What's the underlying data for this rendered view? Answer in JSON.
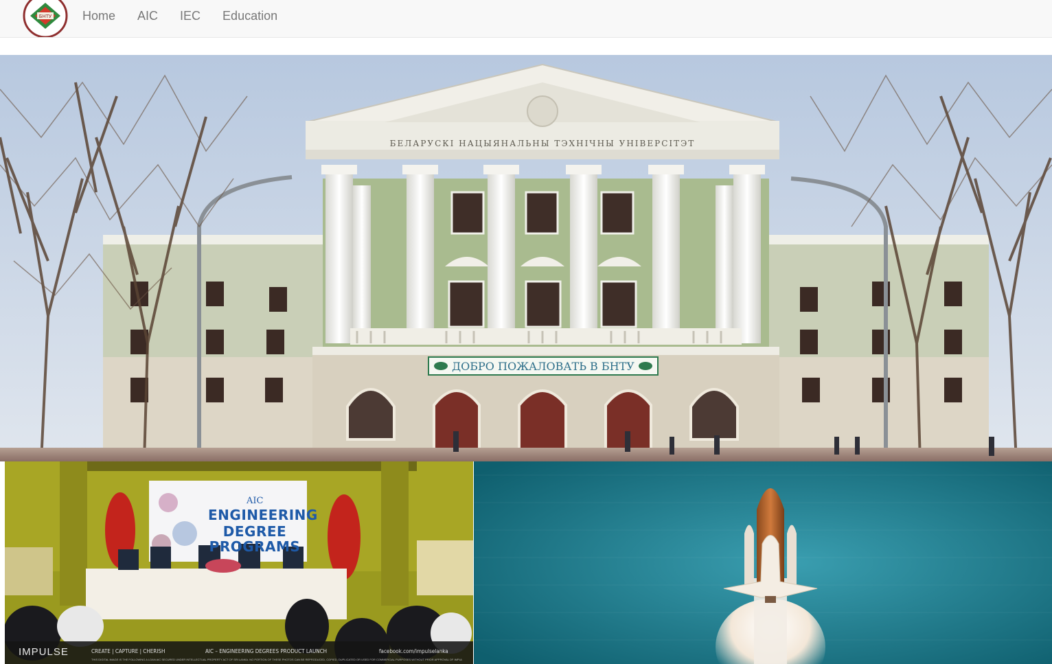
{
  "navbar": {
    "logo_text": "БНТУ",
    "links": [
      "Home",
      "AIC",
      "IEC",
      "Education"
    ]
  },
  "hero": {
    "facade_inscription": "БЕЛАРУСКІ НАЦЫЯНАЛЬНЫ ТЭХНІЧНЫ УНІВЕРСІТЭТ",
    "welcome_banner": "ДОБРО ПОЖАЛОВАТЬ В БНТУ"
  },
  "event_panel": {
    "banner_brand": "AIC",
    "banner_line1": "ENGINEERING",
    "banner_line2": "DEGREE",
    "banner_line3": "PROGRAMS",
    "footer_brand": "IMPULSE",
    "footer_tagline": "CREATE | CAPTURE | CHERISH",
    "footer_caption": "AIC – ENGINEERING DEGREES PRODUCT LAUNCH",
    "footer_social": "facebook.com/impulselanka",
    "footer_fineprint": "THIS DIGITAL IMAGE IS THE FOLLOWING A LOAN AIC SECURED UNDER INTELLECTUAL PROPERTY ACT OF SRI LANKA. NO PORTION OF THESE PHOTOS CAN BE REPRODUCED, COPIED, DUPLICATED OR USED FOR COMMERCIAL PURPOSES WITHOUT PRIOR APPROVAL OF IMPULSE INC."
  },
  "colors": {
    "navbar_bg": "#f8f8f8",
    "nav_link": "#777777",
    "facade_green": "#a9bb8f",
    "banner_blue": "#1e5aa8",
    "launch_teal": "#167a88"
  }
}
